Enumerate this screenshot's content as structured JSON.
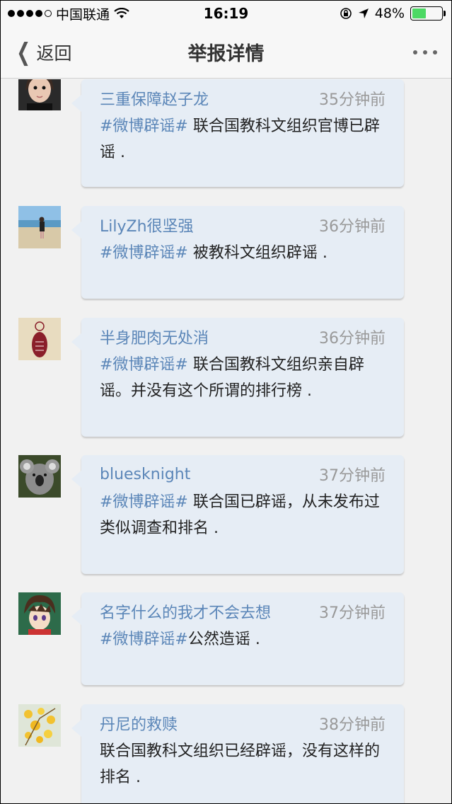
{
  "status_bar": {
    "carrier": "中国联通",
    "time": "16:19",
    "battery": "48%"
  },
  "nav": {
    "back_label": "返回",
    "title": "举报详情"
  },
  "comments": [
    {
      "user": "三重保障赵子龙",
      "time": "35分钟前",
      "tag": "#微博辟谣#",
      "text": " 联合国教科文组织官博已辟谣 ."
    },
    {
      "user": "LilyZh很坚强",
      "time": "36分钟前",
      "tag": "#微博辟谣#",
      "text": " 被教科文组织辟谣 ."
    },
    {
      "user": "半身肥肉无处消",
      "time": "36分钟前",
      "tag": "#微博辟谣#",
      "text": " 联合国教科文组织亲自辟谣。并没有这个所谓的排行榜 ."
    },
    {
      "user": "bluesknight",
      "time": "37分钟前",
      "tag": "#微博辟谣#",
      "text": " 联合国已辟谣，从未发布过类似调查和排名 ."
    },
    {
      "user": "名字什么的我才不会去想",
      "time": "37分钟前",
      "tag": "#微博辟谣#",
      "text": "公然造谣 ."
    },
    {
      "user": "丹尼的救赎",
      "time": "38分钟前",
      "tag": "",
      "text": "联合国教科文组织已经辟谣，没有这样的排名 ."
    }
  ]
}
